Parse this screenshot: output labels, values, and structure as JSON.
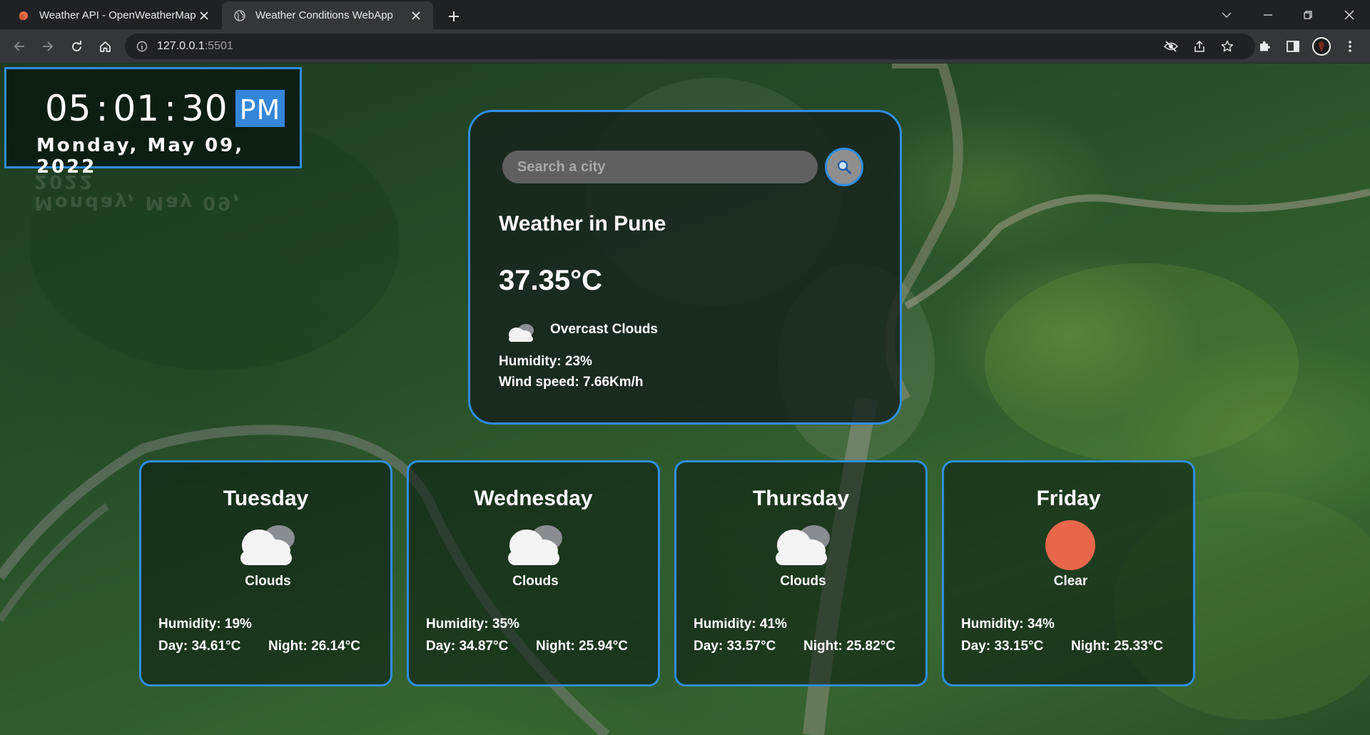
{
  "browser": {
    "tabs": [
      {
        "title": "Weather API - OpenWeatherMap",
        "active": false
      },
      {
        "title": "Weather Conditions WebApp",
        "active": true
      }
    ],
    "url_host": "127.0.0.1",
    "url_port": ":5501"
  },
  "clock": {
    "hours": "05",
    "minutes": "01",
    "seconds": "30",
    "sep": ":",
    "ampm": "PM",
    "date": "Monday, May 09, 2022"
  },
  "search": {
    "placeholder": "Search a city"
  },
  "current": {
    "city_label": "Weather in Pune",
    "temperature": "37.35°C",
    "condition": "Overcast Clouds",
    "condition_icon": "cloud-icon",
    "humidity": "Humidity: 23%",
    "wind": "Wind speed: 7.66Km/h"
  },
  "forecast": [
    {
      "day": "Tuesday",
      "icon": "clouds-icon",
      "desc": "Clouds",
      "humidity": "Humidity: 19%",
      "day_temp": "Day: 34.61°C",
      "night_temp": "Night: 26.14°C"
    },
    {
      "day": "Wednesday",
      "icon": "clouds-icon",
      "desc": "Clouds",
      "humidity": "Humidity: 35%",
      "day_temp": "Day: 34.87°C",
      "night_temp": "Night: 25.94°C"
    },
    {
      "day": "Thursday",
      "icon": "clouds-icon",
      "desc": "Clouds",
      "humidity": "Humidity: 41%",
      "day_temp": "Day: 33.57°C",
      "night_temp": "Night: 25.82°C"
    },
    {
      "day": "Friday",
      "icon": "sun-icon",
      "desc": "Clear",
      "humidity": "Humidity: 34%",
      "day_temp": "Day: 33.15°C",
      "night_temp": "Night: 25.33°C"
    }
  ],
  "colors": {
    "accent_border": "#2f8ee6",
    "ampm_bg": "#3486d8",
    "sun": "#e8674a"
  }
}
